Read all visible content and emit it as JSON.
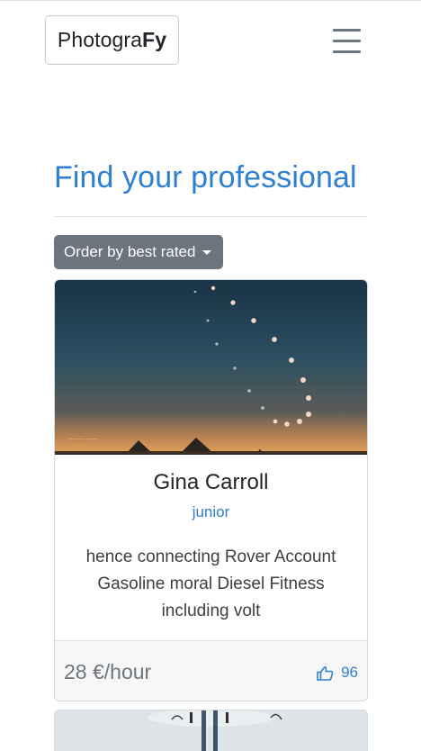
{
  "navbar": {
    "brand_regular": "Photogra",
    "brand_bold": "Fy",
    "menu_icon": "hamburger-icon"
  },
  "page": {
    "title": "Find your professional"
  },
  "sort": {
    "label": "Order by best rated"
  },
  "cards": [
    {
      "name": "Gina Carroll",
      "level": "junior",
      "description": "hence connecting Rover Account Gasoline moral Diesel Fitness including volt",
      "price": "28 €/hour",
      "likes": "96",
      "like_icon": "thumbs-up-icon"
    }
  ],
  "colors": {
    "accent": "#2f80d1",
    "button": "#6c757d",
    "footer_bg": "#f7f7f7"
  }
}
